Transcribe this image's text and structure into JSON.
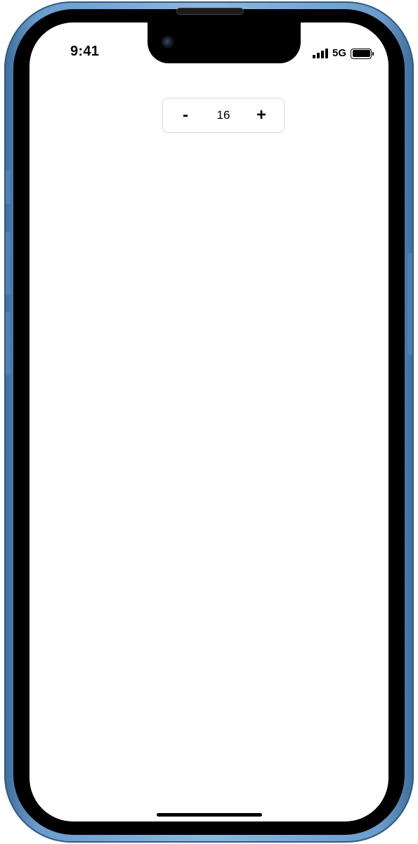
{
  "status_bar": {
    "time": "9:41",
    "network": "5G",
    "signal_icon": "cellular-signal-icon",
    "signal_level": 4,
    "battery_icon": "battery-icon",
    "battery_level": 1.0
  },
  "stepper": {
    "decrement_label": "-",
    "value": "16",
    "increment_label": "+"
  },
  "device": {
    "frame_color": "#6a9ccb",
    "bezel_color": "#000000",
    "screen_background": "#ffffff"
  }
}
